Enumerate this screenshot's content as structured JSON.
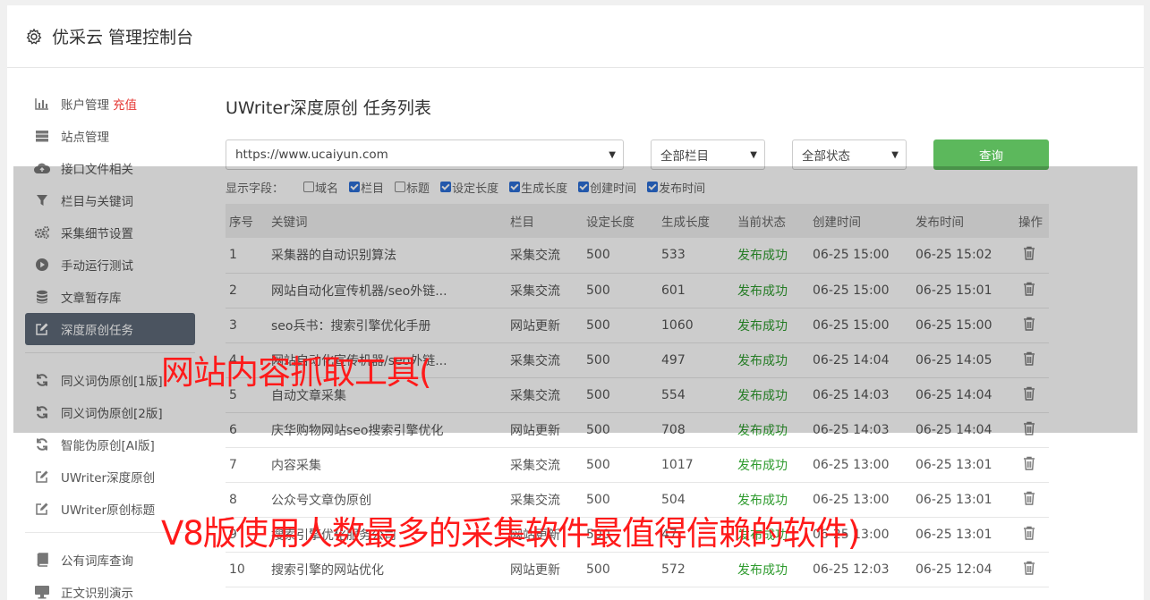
{
  "header": {
    "title": "优采云 管理控制台"
  },
  "sidebar": {
    "items": [
      {
        "label": "账户管理",
        "extra": "充值",
        "icon": "bar-chart-icon"
      },
      {
        "label": "站点管理",
        "icon": "server-icon"
      },
      {
        "label": "接口文件相关",
        "icon": "cloud-upload-icon"
      },
      {
        "label": "栏目与关键词",
        "icon": "filter-icon"
      },
      {
        "label": "采集细节设置",
        "icon": "gears-icon"
      },
      {
        "label": "手动运行测试",
        "icon": "play-circle-icon"
      },
      {
        "label": "文章暂存库",
        "icon": "database-icon"
      },
      {
        "label": "深度原创任务",
        "icon": "edit-icon"
      },
      {
        "label": "同义词伪原创[1版]",
        "icon": "refresh-icon"
      },
      {
        "label": "同义词伪原创[2版]",
        "icon": "refresh-icon"
      },
      {
        "label": "智能伪原创[AI版]",
        "icon": "refresh-icon"
      },
      {
        "label": "UWriter深度原创",
        "icon": "edit-icon"
      },
      {
        "label": "UWriter原创标题",
        "icon": "edit-icon"
      },
      {
        "label": "公有词库查询",
        "icon": "book-icon"
      },
      {
        "label": "正文识别演示",
        "icon": "desktop-icon"
      }
    ]
  },
  "main": {
    "title": "UWriter深度原创 任务列表",
    "site_select": "https://www.ucaiyun.com",
    "column_select": "全部栏目",
    "status_select": "全部状态",
    "query_button": "查询",
    "fields_label": "显示字段：",
    "fields": [
      {
        "label": "域名",
        "checked": false
      },
      {
        "label": "栏目",
        "checked": true
      },
      {
        "label": "标题",
        "checked": false
      },
      {
        "label": "设定长度",
        "checked": true
      },
      {
        "label": "生成长度",
        "checked": true
      },
      {
        "label": "创建时间",
        "checked": true
      },
      {
        "label": "发布时间",
        "checked": true
      }
    ],
    "table": {
      "headers": [
        "序号",
        "关键词",
        "栏目",
        "设定长度",
        "生成长度",
        "当前状态",
        "创建时间",
        "发布时间",
        "操作"
      ],
      "rows": [
        [
          "1",
          "采集器的自动识别算法",
          "采集交流",
          "500",
          "533",
          "发布成功",
          "06-25 15:00",
          "06-25 15:02"
        ],
        [
          "2",
          "网站自动化宣传机器/seo外链...",
          "采集交流",
          "500",
          "601",
          "发布成功",
          "06-25 15:00",
          "06-25 15:01"
        ],
        [
          "3",
          "seo兵书：搜索引擎优化手册",
          "网站更新",
          "500",
          "1060",
          "发布成功",
          "06-25 15:00",
          "06-25 15:00"
        ],
        [
          "4",
          "网站自动化宣传机器/seo外链...",
          "采集交流",
          "500",
          "497",
          "发布成功",
          "06-25 14:04",
          "06-25 14:05"
        ],
        [
          "5",
          "自动文章采集",
          "采集交流",
          "500",
          "554",
          "发布成功",
          "06-25 14:03",
          "06-25 14:04"
        ],
        [
          "6",
          "庆华购物网站seo搜索引擎优化",
          "网站更新",
          "500",
          "708",
          "发布成功",
          "06-25 14:03",
          "06-25 14:04"
        ],
        [
          "7",
          "内容采集",
          "采集交流",
          "500",
          "1017",
          "发布成功",
          "06-25 13:00",
          "06-25 13:01"
        ],
        [
          "8",
          "公众号文章伪原创",
          "采集交流",
          "500",
          "504",
          "发布成功",
          "06-25 13:00",
          "06-25 13:01"
        ],
        [
          "9",
          "搜索引擎优化服务公司",
          "网站更新",
          "500",
          "47",
          "发布成功",
          "06-25 13:00",
          "06-25 13:01"
        ],
        [
          "10",
          "搜索引擎的网站优化",
          "网站更新",
          "500",
          "572",
          "发布成功",
          "06-25 12:03",
          "06-25 12:04"
        ]
      ]
    }
  },
  "watermarks": {
    "line1": "网站内容抓取工具(",
    "line2": "V8版使用人数最多的采集软件最值得信赖的软件)"
  },
  "colors": {
    "accent_green": "#5cb85c",
    "status_green": "#2e9b2e",
    "active_nav": "#5e6a79",
    "watermark_red": "#ff1a1a",
    "checkbox_blue": "#2c6fd6"
  }
}
